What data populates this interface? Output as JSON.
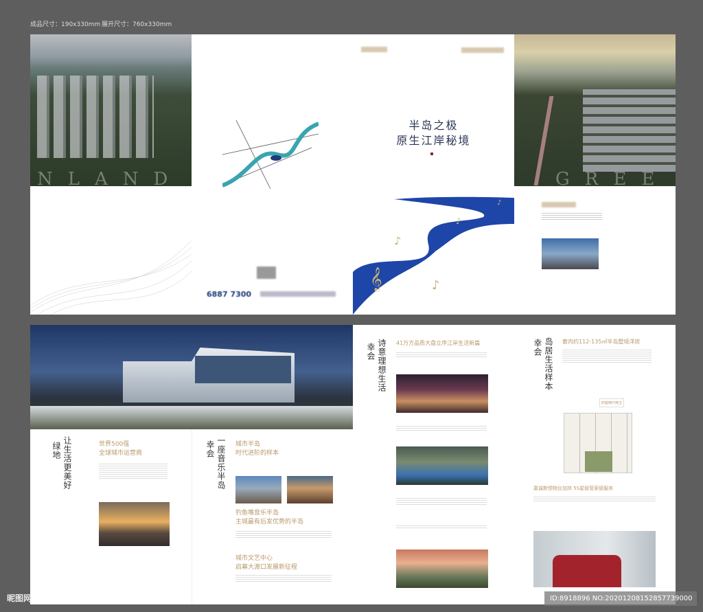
{
  "spec": {
    "finished_size": "成品尺寸：190x330mm",
    "open_size": "展开尺寸：760x330mm"
  },
  "cover": {
    "title_line1": "半岛之极",
    "title_line2": "原生江岸秘境",
    "phone": "6887 7300"
  },
  "page1": {
    "bg_letters": "NLAND"
  },
  "page4": {
    "bg_letters": "GREE"
  },
  "spread2": {
    "v_title_a": "绿地",
    "v_title_b": "让生活更美好",
    "headline1_line1": "世界500强",
    "headline1_line2": "全球城市运营商",
    "v_title2_a": "幸会",
    "v_title2_b": "一座音乐半岛",
    "headline2_line1": "城市半岛",
    "headline2_line2": "时代进阶的样本",
    "headline3_line1": "钓鱼嘴音乐半岛",
    "headline3_line2": "主城最有后发优势的半岛",
    "headline4_line1": "城市文艺中心",
    "headline4_line2": "启幕大渡口发展新征程"
  },
  "page7": {
    "v_title_a": "幸会",
    "v_title_b": "诗意理想生活",
    "headline": "41万方品质大盘立序江岸生活新篇"
  },
  "page8": {
    "v_title_a": "幸会",
    "v_title_b": "岛居生活样本",
    "headline": "套内约112-135㎡半岛墅境洋房",
    "unit_type": "四室两厅两卫",
    "service_headline": "嘉诚新悦物业加持 5S星级管家级服务"
  },
  "watermark": {
    "site": "昵图网 www.nipic.com",
    "id": "ID:8918896 NO:20201208152857739000"
  }
}
